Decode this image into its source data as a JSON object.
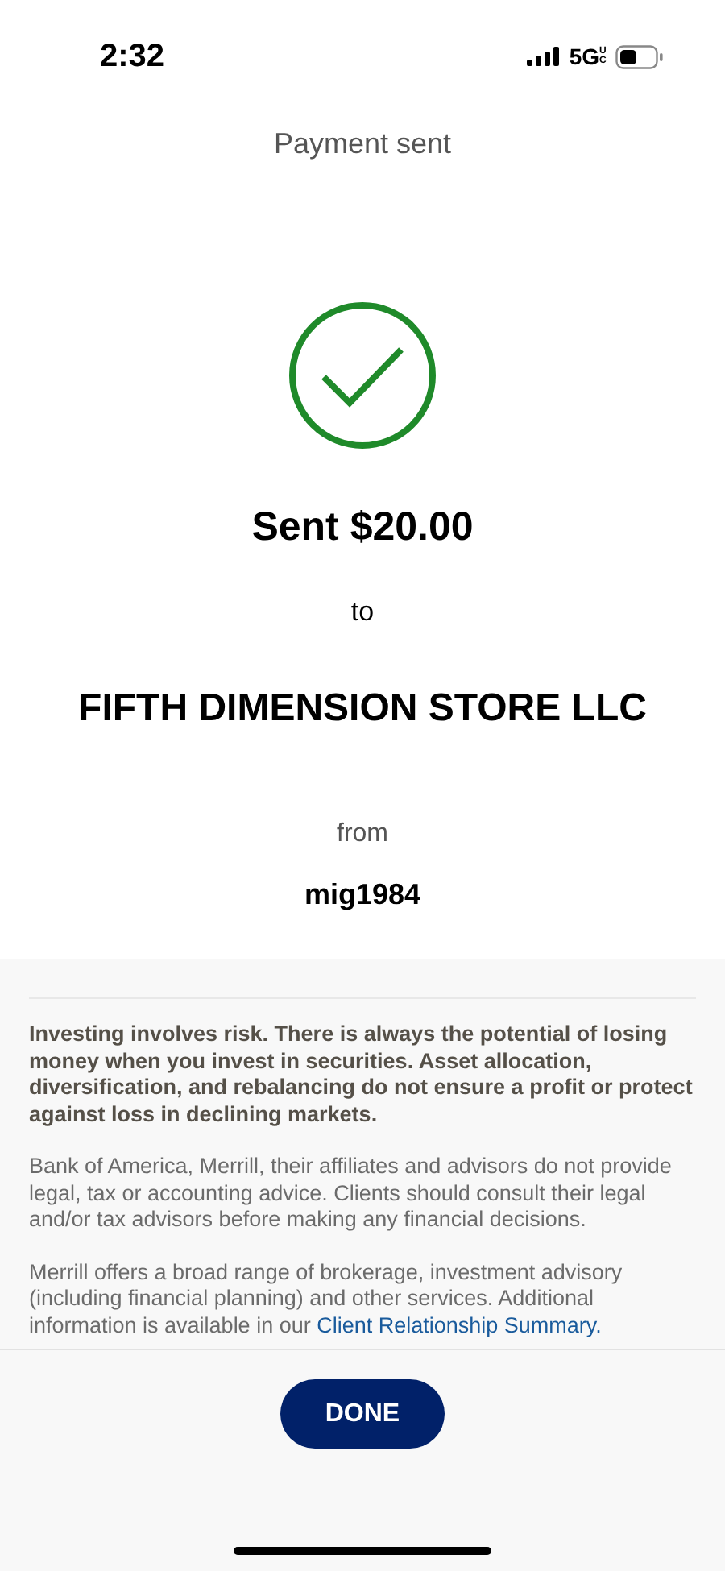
{
  "status_bar": {
    "time": "2:32",
    "network": "5G",
    "network_suffix": "UC"
  },
  "header": {
    "title": "Payment sent"
  },
  "confirmation": {
    "amount_line": "Sent $20.00",
    "to_label": "to",
    "payee": "FIFTH DIMENSION STORE LLC",
    "from_label": "from",
    "account": "mig1984"
  },
  "disclosures": [
    {
      "kind": "bold",
      "text": "Investing involves risk. There is always the potential of losing money when you invest in securities. Asset allocation, diversification, and rebalancing do not ensure a profit or protect against loss in declining markets."
    },
    {
      "kind": "plain",
      "text": "Bank of America, Merrill, their affiliates and advisors do not provide legal, tax or accounting advice. Clients should consult their legal and/or tax advisors before making any financial decisions."
    },
    {
      "kind": "link",
      "text": "Merrill offers a broad range of brokerage, investment advisory (including financial planning) and other services. Additional information is available in our",
      "link": "Client Relationship Summary."
    }
  ],
  "done_button": "DONE"
}
